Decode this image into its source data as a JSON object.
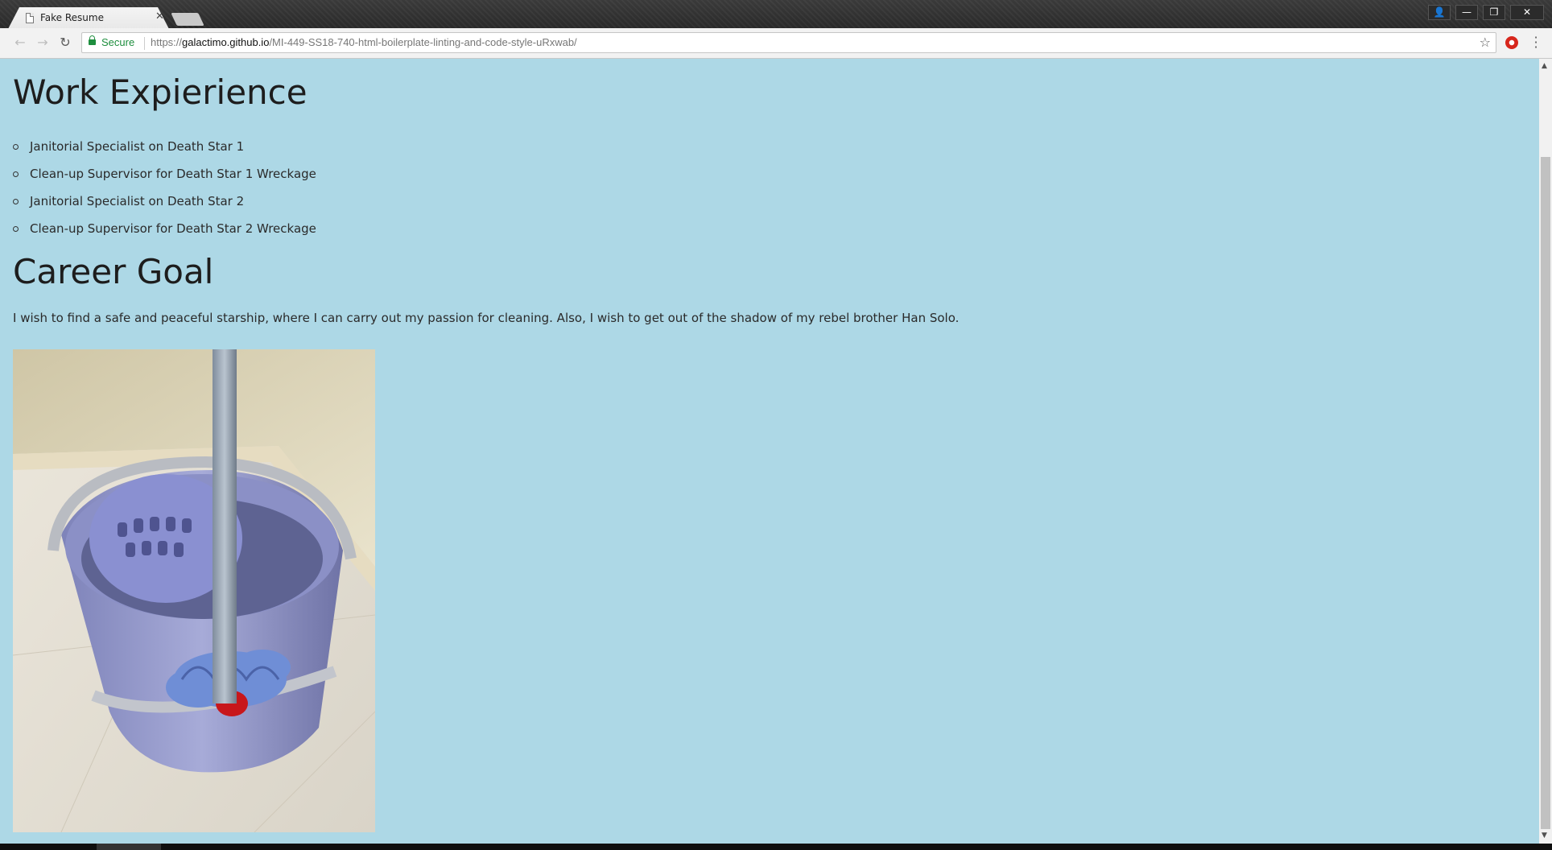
{
  "browser": {
    "tab_title": "Fake Resume",
    "tab_close": "✕",
    "secure_label": "Secure",
    "url_scheme": "https://",
    "url_host": "galactimo.github.io",
    "url_path": "/MI-449-SS18-740-html-boilerplate-linting-and-code-style-uRxwab/",
    "window_controls": {
      "user": "👤",
      "minimize": "—",
      "restore": "❐",
      "close": "✕"
    }
  },
  "page": {
    "background_color": "#add8e6",
    "work_heading": "Work Expierience",
    "jobs": [
      "Janitorial Specialist on Death Star 1",
      "Clean-up Supervisor for Death Star 1 Wreckage",
      "Janitorial Specialist on Death Star 2",
      "Clean-up Supervisor for Death Star 2 Wreckage"
    ],
    "career_heading": "Career Goal",
    "career_goal": "I wish to find a safe and peaceful starship, where I can carry out my passion for cleaning. Also, I wish to get out of the shadow of my rebel brother Han Solo.",
    "image_subject": "mop in a mop bucket"
  }
}
